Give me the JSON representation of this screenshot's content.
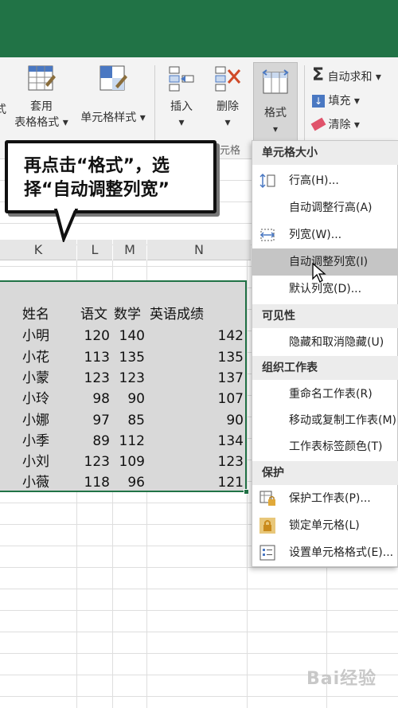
{
  "ribbon": {
    "partial_left": "式",
    "table_format_label1": "套用",
    "table_format_label2": "表格格式",
    "cell_style_label": "单元格样式",
    "insert_label": "插入",
    "delete_label": "删除",
    "format_label": "格式",
    "cells_group_label": "元格",
    "autosum_label": "自动求和",
    "fill_label": "填充",
    "clear_label": "清除"
  },
  "callout": {
    "line1": "再点击“格式”，选",
    "line2": "择“自动调整列宽”"
  },
  "columns": {
    "k": "K",
    "l": "L",
    "m": "M",
    "n": "N"
  },
  "table": {
    "headers": [
      "姓名",
      "语文",
      "数学",
      "英语成绩"
    ],
    "rows": [
      [
        "小明",
        "120",
        "140",
        "142"
      ],
      [
        "小花",
        "113",
        "135",
        "135"
      ],
      [
        "小蒙",
        "123",
        "123",
        "137"
      ],
      [
        "小玲",
        "98",
        "90",
        "107"
      ],
      [
        "小娜",
        "97",
        "85",
        "90"
      ],
      [
        "小季",
        "89",
        "112",
        "134"
      ],
      [
        "小刘",
        "123",
        "109",
        "123"
      ],
      [
        "小薇",
        "118",
        "96",
        "121"
      ]
    ]
  },
  "menu": {
    "sec_size": "单元格大小",
    "row_height": "行高(H)...",
    "autofit_row": "自动调整行高(A)",
    "col_width": "列宽(W)...",
    "autofit_col": "自动调整列宽(I)",
    "default_width": "默认列宽(D)...",
    "sec_visibility": "可见性",
    "hide_unhide": "隐藏和取消隐藏(U)",
    "sec_organize": "组织工作表",
    "rename": "重命名工作表(R)",
    "move_copy": "移动或复制工作表(M)",
    "tab_color": "工作表标签颜色(T)",
    "sec_protect": "保护",
    "protect_sheet": "保护工作表(P)...",
    "lock_cell": "锁定单元格(L)",
    "format_cells": "设置单元格格式(E)..."
  },
  "watermark": "Bai经验"
}
